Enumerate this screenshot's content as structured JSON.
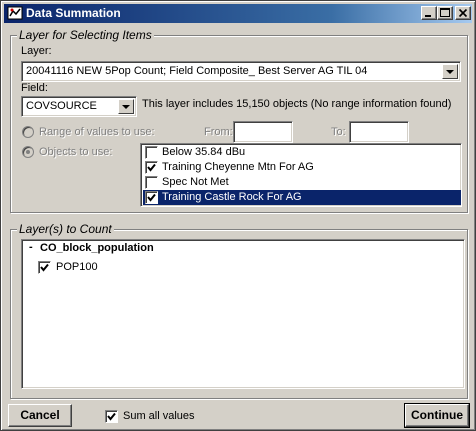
{
  "window": {
    "title": "Data Summation"
  },
  "layer_group": {
    "title": "Layer for Selecting Items",
    "layer_label": "Layer:",
    "layer_value": "20041116 NEW 5Pop Count; Field Composite_ Best Server AG TIL 04",
    "field_label": "Field:",
    "field_value": "COVSOURCE",
    "info_text": "This layer includes 15,150 objects (No range information found)",
    "range_label": "Range of values to use:",
    "from_label": "From:",
    "to_label": "To:",
    "from_value": "",
    "to_value": "",
    "objects_label": "Objects to use:",
    "objects": [
      {
        "label": "Below 35.84 dBu",
        "checked": false,
        "selected": false
      },
      {
        "label": "Training Cheyenne Mtn For AG",
        "checked": true,
        "selected": false
      },
      {
        "label": "Spec Not Met",
        "checked": false,
        "selected": false
      },
      {
        "label": "Training Castle Rock For AG",
        "checked": true,
        "selected": true
      }
    ]
  },
  "count_group": {
    "title": "Layer(s) to Count",
    "tree_expander": "-",
    "tree_root": "CO_block_population",
    "tree_child": "POP100",
    "tree_child_checked": true
  },
  "footer": {
    "cancel_label": "Cancel",
    "sum_label": "Sum all values",
    "sum_checked": true,
    "continue_label": "Continue"
  }
}
